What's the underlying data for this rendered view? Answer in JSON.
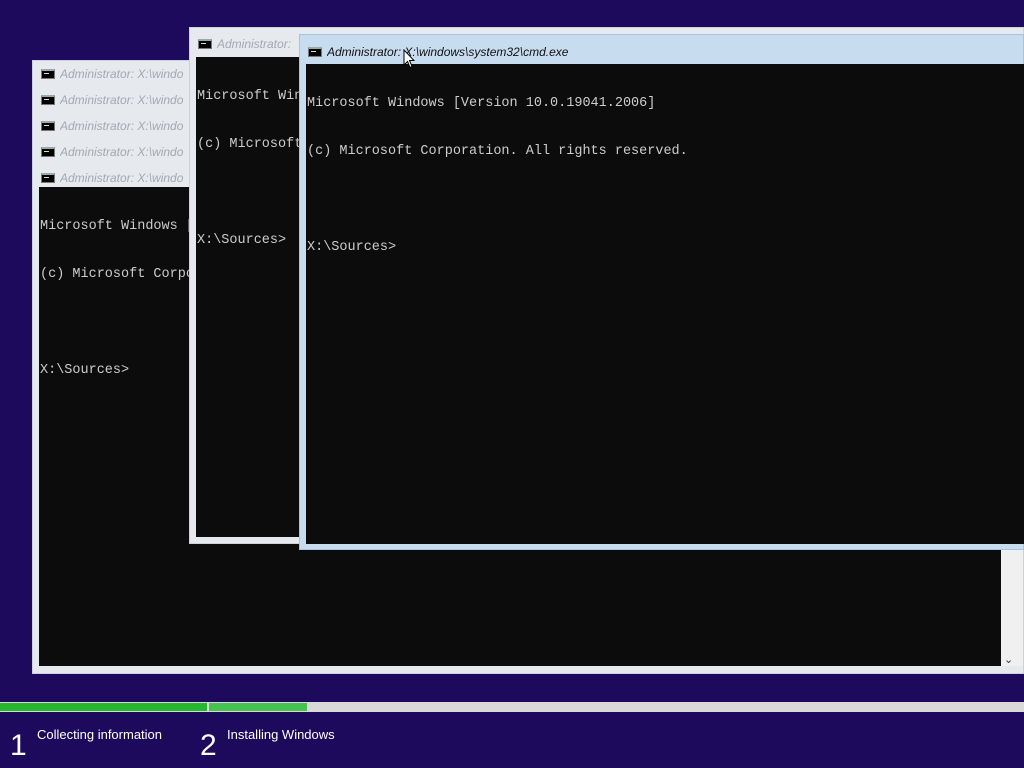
{
  "windows": {
    "cascade_titles": [
      "Administrator: X:\\windo",
      "Administrator: X:\\windo",
      "Administrator: X:\\windo",
      "Administrator: X:\\windo",
      "Administrator: X:\\windo"
    ],
    "bottom_window": {
      "lines": [
        "Microsoft Windows [",
        "(c) Microsoft Corpo",
        "",
        "X:\\Sources>"
      ]
    },
    "middle_window": {
      "title": "Administrator: ",
      "lines": [
        "Microsoft Win",
        "(c) Microsoft",
        "",
        "X:\\Sources>"
      ]
    },
    "active_window": {
      "title": "Administrator: X:\\windows\\system32\\cmd.exe",
      "lines": [
        "Microsoft Windows [Version 10.0.19041.2006]",
        "(c) Microsoft Corporation. All rights reserved.",
        "",
        "X:\\Sources>"
      ]
    },
    "scroll_down_glyph": "⌄"
  },
  "setup_progress": {
    "completed_fraction": 0.3,
    "colors": {
      "done": "#25b72d",
      "current": "#46c34e",
      "track": "#d9d9d9",
      "background": "#1e0a5c"
    },
    "steps": [
      {
        "number": "1",
        "label": "Collecting information"
      },
      {
        "number": "2",
        "label": "Installing Windows"
      }
    ]
  }
}
